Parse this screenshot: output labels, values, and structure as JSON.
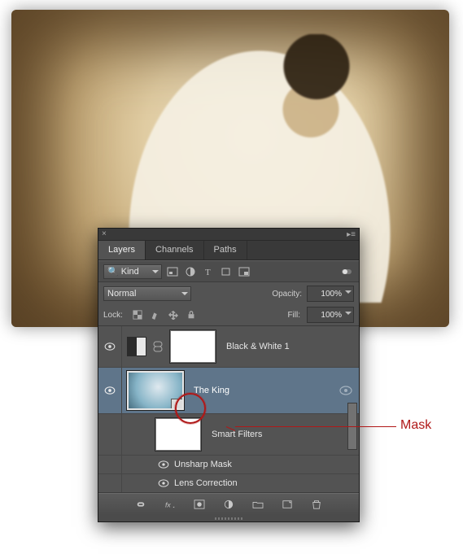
{
  "tabs": {
    "layers": "Layers",
    "channels": "Channels",
    "paths": "Paths"
  },
  "filterRow": {
    "kind": "Kind",
    "icons": [
      "pixel-layer-icon",
      "adjustment-layer-icon",
      "type-layer-icon",
      "shape-layer-icon",
      "smart-object-icon"
    ]
  },
  "blend": {
    "mode": "Normal",
    "opacityLabel": "Opacity:",
    "opacity": "100%"
  },
  "lock": {
    "label": "Lock:",
    "fillLabel": "Fill:",
    "fill": "100%"
  },
  "layers": {
    "adj": "Black & White 1",
    "smart": "The King",
    "sf": "Smart Filters",
    "f1": "Unsharp Mask",
    "f2": "Lens Correction"
  },
  "callout": "Mask"
}
